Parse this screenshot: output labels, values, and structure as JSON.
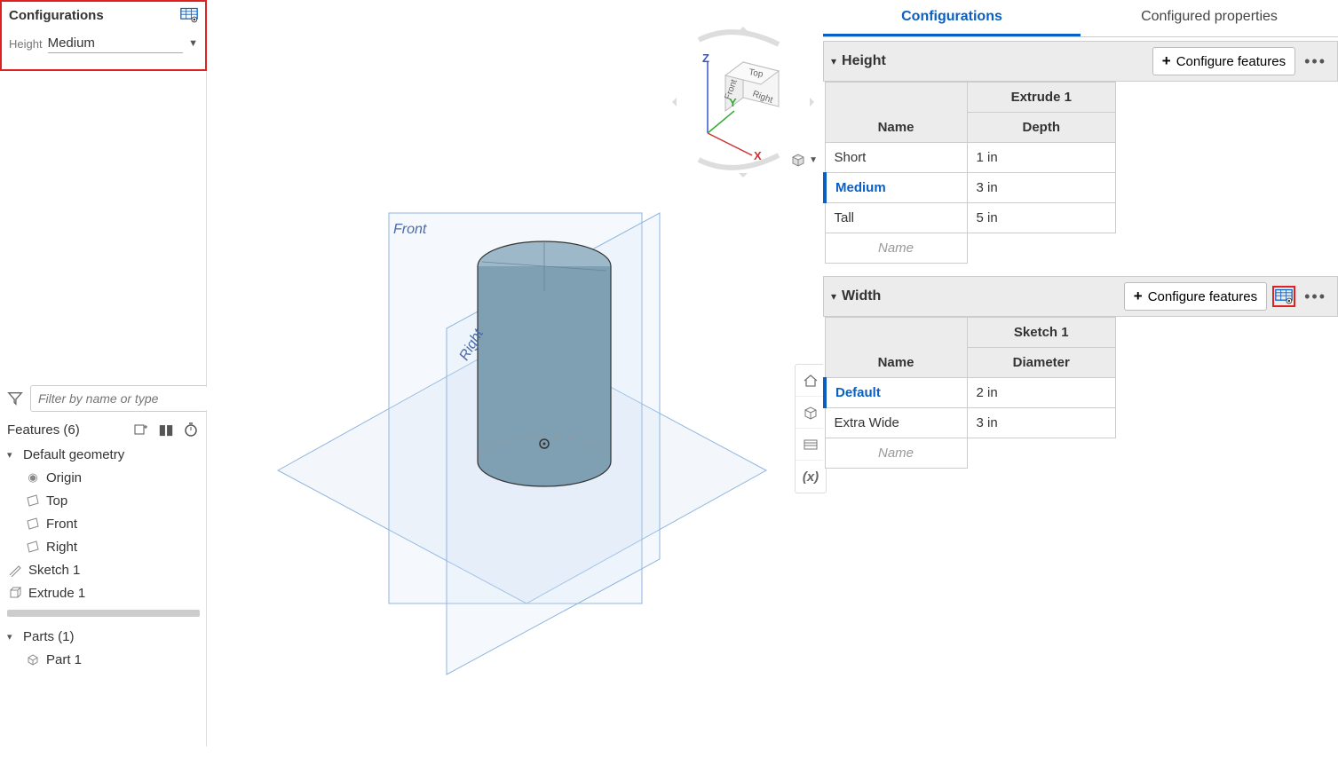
{
  "left": {
    "config_title": "Configurations",
    "height_label": "Height",
    "height_value": "Medium",
    "filter_placeholder": "Filter by name or type",
    "features_header": "Features (6)",
    "default_geometry": "Default geometry",
    "origin": "Origin",
    "top": "Top",
    "front": "Front",
    "right": "Right",
    "sketch1": "Sketch 1",
    "extrude1": "Extrude 1",
    "parts_header": "Parts (1)",
    "part1": "Part 1"
  },
  "viewport": {
    "plane_front": "Front",
    "plane_right": "Right",
    "axis_x": "X",
    "axis_y": "Y",
    "axis_z": "Z",
    "cube_top": "Top",
    "cube_front": "Front",
    "cube_right": "Right"
  },
  "right": {
    "tab_configs": "Configurations",
    "tab_props": "Configured properties",
    "configure_features": "Configure features",
    "height": {
      "title": "Height",
      "col_feature": "Extrude 1",
      "col_name": "Name",
      "col_param": "Depth",
      "rows": [
        {
          "name": "Short",
          "value": "1 in"
        },
        {
          "name": "Medium",
          "value": "3 in"
        },
        {
          "name": "Tall",
          "value": "5 in"
        }
      ],
      "placeholder": "Name"
    },
    "width": {
      "title": "Width",
      "col_feature": "Sketch 1",
      "col_name": "Name",
      "col_param": "Diameter",
      "rows": [
        {
          "name": "Default",
          "value": "2 in"
        },
        {
          "name": "Extra Wide",
          "value": "3 in"
        }
      ],
      "placeholder": "Name"
    }
  }
}
